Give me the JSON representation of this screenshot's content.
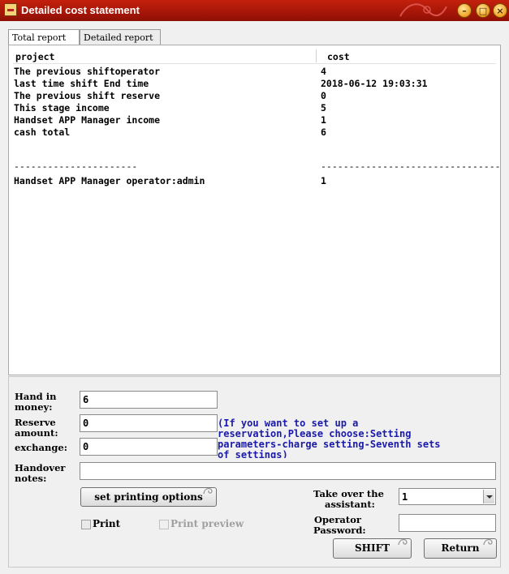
{
  "window": {
    "title": "Detailed cost statement"
  },
  "tabs": [
    {
      "label": "Total report"
    },
    {
      "label": "Detailed report"
    }
  ],
  "report": {
    "headers": {
      "project": "project",
      "cost": "cost"
    },
    "rows": [
      {
        "label": "The previous shiftoperator",
        "value": "4"
      },
      {
        "label": "last time shift End time",
        "value": "2018-06-12 19:03:31"
      },
      {
        "label": "The previous shift reserve",
        "value": "0"
      },
      {
        "label": "This stage income",
        "value": "5"
      },
      {
        "label": "Handset APP Manager income",
        "value": "1"
      },
      {
        "label": "cash total",
        "value": "6"
      }
    ],
    "separator_left": "----------------------",
    "separator_right": "--------------------------------",
    "footer": {
      "label": "Handset APP Manager operator:admin",
      "value": "1"
    }
  },
  "form": {
    "hand_in_label_1": "Hand in",
    "hand_in_label_2": "money:",
    "hand_in_value": "6",
    "reserve_label_1": "Reserve",
    "reserve_label_2": "amount:",
    "reserve_value": "0",
    "exchange_label": "exchange:",
    "exchange_value": "0",
    "reserve_note": "(If you want to set up a reservation,Please choose:Setting parameters-charge setting-Seventh sets of settings)",
    "handover_label_1": "Handover",
    "handover_label_2": "notes:",
    "handover_value": "",
    "print_options_button": "set printing options",
    "print_label": "Print",
    "print_preview_label": "Print preview",
    "assistant_label_1": "Take over the",
    "assistant_label_2": "assistant:",
    "assistant_value": "1",
    "password_label_1": "Operator",
    "password_label_2": "Password:",
    "password_value": "",
    "shift_button": "SHIFT",
    "return_button": "Return"
  }
}
